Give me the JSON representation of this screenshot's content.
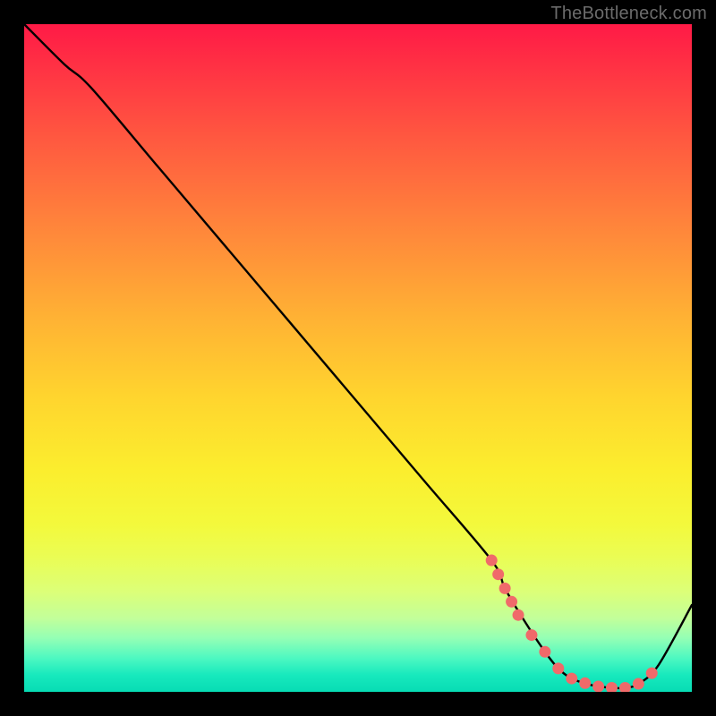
{
  "watermark": "TheBottleneck.com",
  "chart_data": {
    "type": "line",
    "title": "",
    "xlabel": "",
    "ylabel": "",
    "xlim": [
      0,
      100
    ],
    "ylim": [
      0,
      100
    ],
    "series": [
      {
        "name": "curve",
        "x": [
          0,
          6,
          10,
          20,
          30,
          40,
          50,
          60,
          70,
          72,
          75,
          78,
          80,
          82,
          85,
          88,
          90,
          92,
          95,
          100
        ],
        "y": [
          100,
          94,
          90.5,
          78.7,
          66.9,
          55.1,
          43.3,
          31.5,
          19.7,
          15.5,
          10.5,
          6.0,
          3.5,
          2.0,
          1.0,
          0.6,
          0.6,
          1.2,
          4.0,
          13.0
        ]
      }
    ],
    "markers": {
      "name": "dots",
      "x": [
        70,
        71,
        72,
        73,
        74,
        76,
        78,
        80,
        82,
        84,
        86,
        88,
        90,
        92,
        94
      ],
      "y": [
        19.7,
        17.6,
        15.5,
        13.5,
        11.5,
        8.5,
        6.0,
        3.5,
        2.0,
        1.3,
        0.8,
        0.6,
        0.6,
        1.2,
        2.8
      ]
    },
    "colors": {
      "curve_stroke": "#000000",
      "marker_fill": "#f06a6a"
    }
  }
}
